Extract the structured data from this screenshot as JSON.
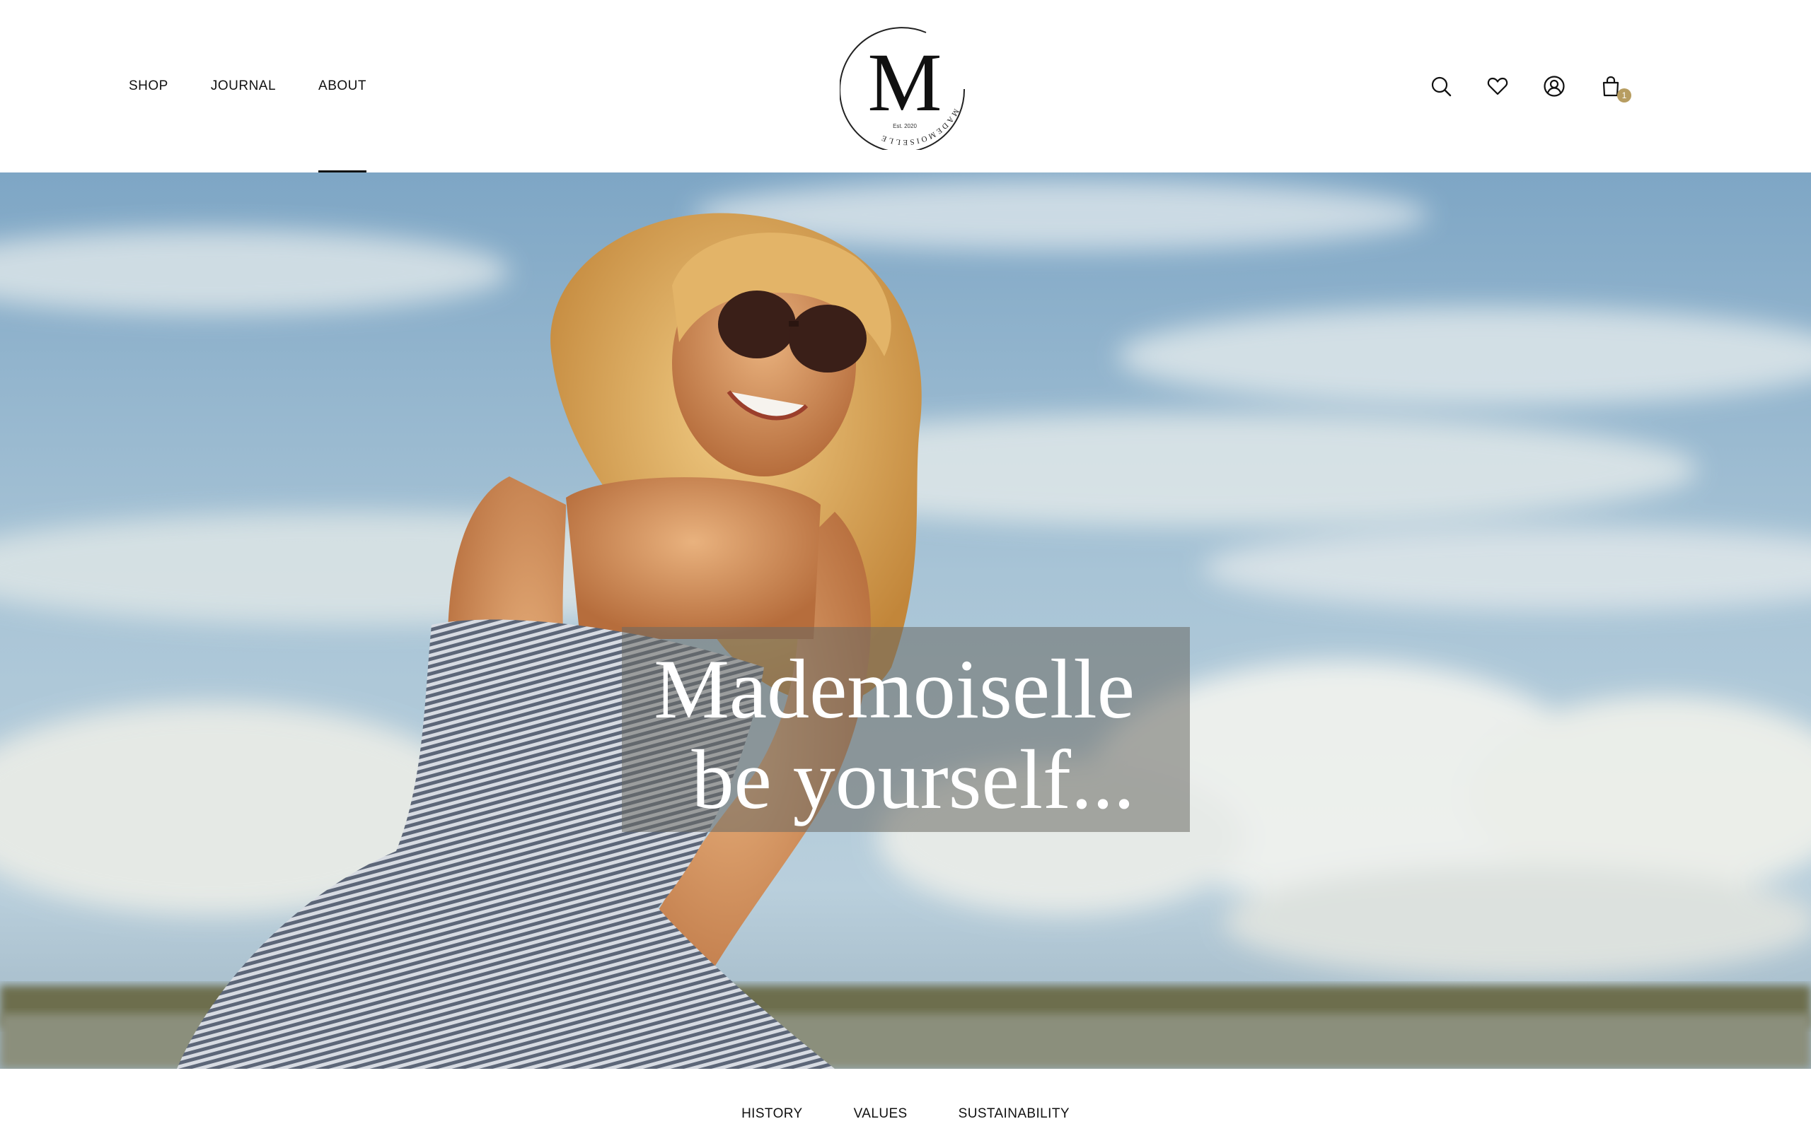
{
  "header": {
    "nav_left": [
      {
        "label": "SHOP"
      },
      {
        "label": "JOURNAL"
      },
      {
        "label": "ABOUT"
      }
    ],
    "active_nav": "ABOUT",
    "logo": {
      "monogram": "M",
      "ring_text": "MADEMOISELLE",
      "est": "Est. 2020"
    },
    "icons": [
      "search-icon",
      "heart-icon",
      "account-icon",
      "bag-icon"
    ],
    "cart_count": "1"
  },
  "hero": {
    "line1": "Mademoiselle",
    "line2": "be yourself..."
  },
  "subnav": [
    {
      "label": "HISTORY"
    },
    {
      "label": "VALUES"
    },
    {
      "label": "SUSTAINABILITY"
    }
  ],
  "colors": {
    "badge": "#b79d61",
    "text": "#111111",
    "sky": "#8fb3cf"
  }
}
